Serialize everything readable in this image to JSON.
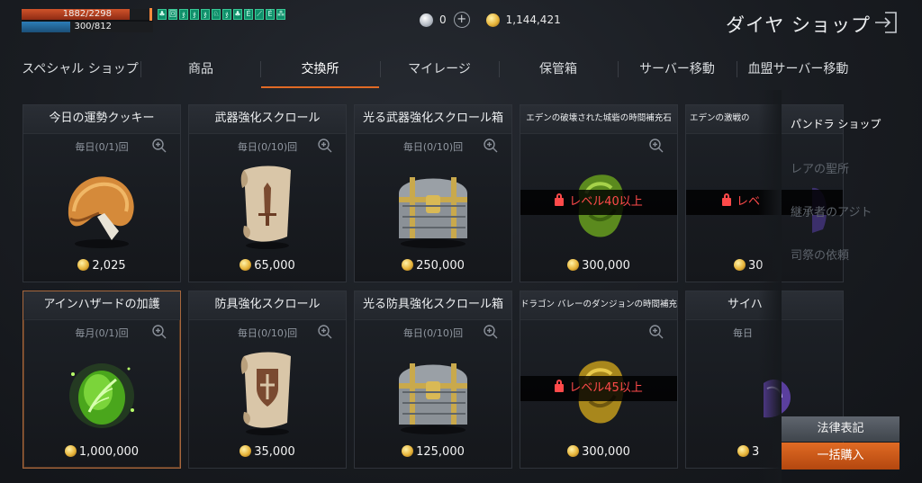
{
  "status": {
    "hp_text": "1882/2298",
    "hp_fraction": 0.819,
    "mp_text": "300/812",
    "mp_fraction": 0.369,
    "buff_icons": [
      "♣",
      "回",
      "ჯ",
      "ჯ",
      "ჯ",
      "♘",
      "ჯ",
      "♣",
      "Ѐ",
      "⟋",
      "Ѐ",
      "⁂"
    ]
  },
  "currency": {
    "diamond_count": "0",
    "gold_count": "1,144,421"
  },
  "title": "ダイヤ ショップ",
  "tabs": [
    {
      "label": "スペシャル ショップ"
    },
    {
      "label": "商品"
    },
    {
      "label": "交換所"
    },
    {
      "label": "マイレージ"
    },
    {
      "label": "保管箱"
    },
    {
      "label": "サーバー移動"
    },
    {
      "label": "血盟サーバー移動"
    }
  ],
  "active_tab": "交換所",
  "items": [
    {
      "name": "今日の運勢クッキー",
      "limit": "毎日(0/1)回",
      "price": "2,025"
    },
    {
      "name": "武器強化スクロール",
      "limit": "毎日(0/10)回",
      "price": "65,000"
    },
    {
      "name": "光る武器強化スクロール箱",
      "limit": "毎日(0/10)回",
      "price": "250,000"
    },
    {
      "name": "エデンの破壊された城砦の時間補充石",
      "limit": "",
      "price": "300,000",
      "lock": "レベル40以上"
    },
    {
      "name": "エデンの激戦の",
      "limit": "",
      "price": "30",
      "lock": "レベ"
    },
    {
      "name": "アインハザードの加護",
      "limit": "毎月(0/1)回",
      "price": "1,000,000"
    },
    {
      "name": "防具強化スクロール",
      "limit": "毎日(0/10)回",
      "price": "35,000"
    },
    {
      "name": "光る防具強化スクロール箱",
      "limit": "毎日(0/10)回",
      "price": "125,000"
    },
    {
      "name": "ドラゴン バレーのダンジョンの時間補充石",
      "limit": "",
      "price": "300,000",
      "lock": "レベル45以上"
    },
    {
      "name": "サイハ",
      "limit": "毎日",
      "price": "3"
    }
  ],
  "side_menu": [
    {
      "label": "パンドラ ショップ"
    },
    {
      "label": "レアの聖所"
    },
    {
      "label": "継承者のアジト"
    },
    {
      "label": "司祭の依頼"
    }
  ],
  "buttons": {
    "legal": "法律表記",
    "bulk_buy": "一括購入"
  },
  "colors": {
    "accent": "#e06a25",
    "lock_red": "#ff4a4a",
    "gold": "#e7b43a"
  }
}
